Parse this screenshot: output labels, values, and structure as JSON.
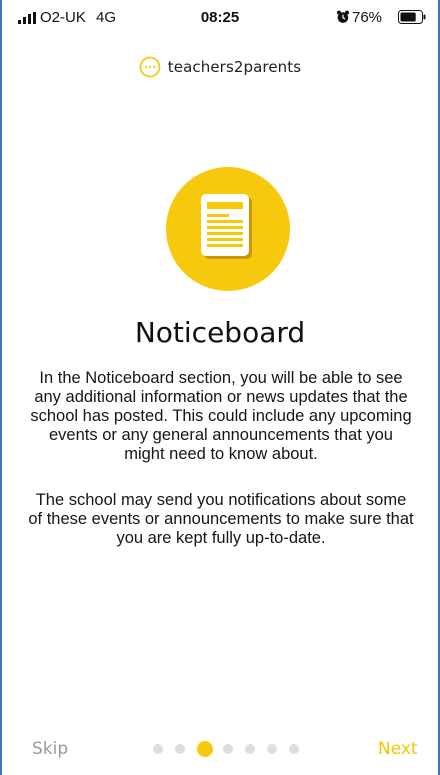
{
  "status_bar": {
    "carrier": "O2-UK",
    "network": "4G",
    "time": "08:25",
    "battery_percent": "76%",
    "icons": [
      "signal-strength-icon",
      "alarm-clock-icon",
      "battery-icon"
    ]
  },
  "brand": {
    "name": "teachers2parents",
    "logo_icon": "speech-bubble-dots-icon"
  },
  "hero": {
    "icon": "document-icon",
    "title": "Noticeboard"
  },
  "body": {
    "paragraph_1": "In the Noticeboard section, you will be able to see any additional information or news updates that the school has posted. This could include any upcoming events or any general announcements that you might need to know about.",
    "paragraph_2": "The school may send you notifications about some of these events or announcements to make sure that you are kept fully up-to-date."
  },
  "navigation": {
    "skip_label": "Skip",
    "next_label": "Next",
    "page_indicator": {
      "total_pages": 7,
      "current_page": 3
    }
  },
  "colors": {
    "accent_yellow": "#f6c90d",
    "next_text": "#f3c700",
    "skip_text": "#9a9a9a",
    "inactive_dot": "#dddddd",
    "frame_blue": "#3f74b8"
  }
}
